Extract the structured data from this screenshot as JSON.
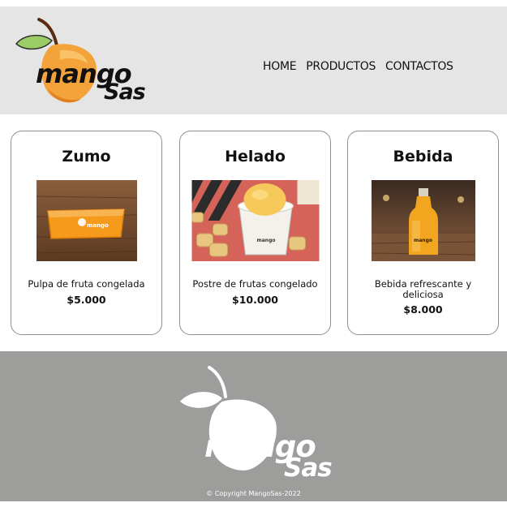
{
  "brand": {
    "word1": "mango",
    "word2": "Sas"
  },
  "nav": [
    {
      "label": "HOME"
    },
    {
      "label": "PRODUCTOS"
    },
    {
      "label": "CONTACTOS"
    }
  ],
  "products": [
    {
      "title": "Zumo",
      "description": "Pulpa de fruta congelada",
      "price": "$5.000"
    },
    {
      "title": "Helado",
      "description": "Postre de frutas congelado",
      "price": "$10.000"
    },
    {
      "title": "Bebida",
      "description": "Bebida refrescante y deliciosa",
      "price": "$8.000"
    }
  ],
  "footer": {
    "copyright": "© Copyright MangoSas-2022"
  },
  "colors": {
    "header_bg": "#e5e5e5",
    "footer_bg": "#9d9d9c",
    "mango_orange": "#f4a23a",
    "leaf_green": "#8dc63f"
  }
}
